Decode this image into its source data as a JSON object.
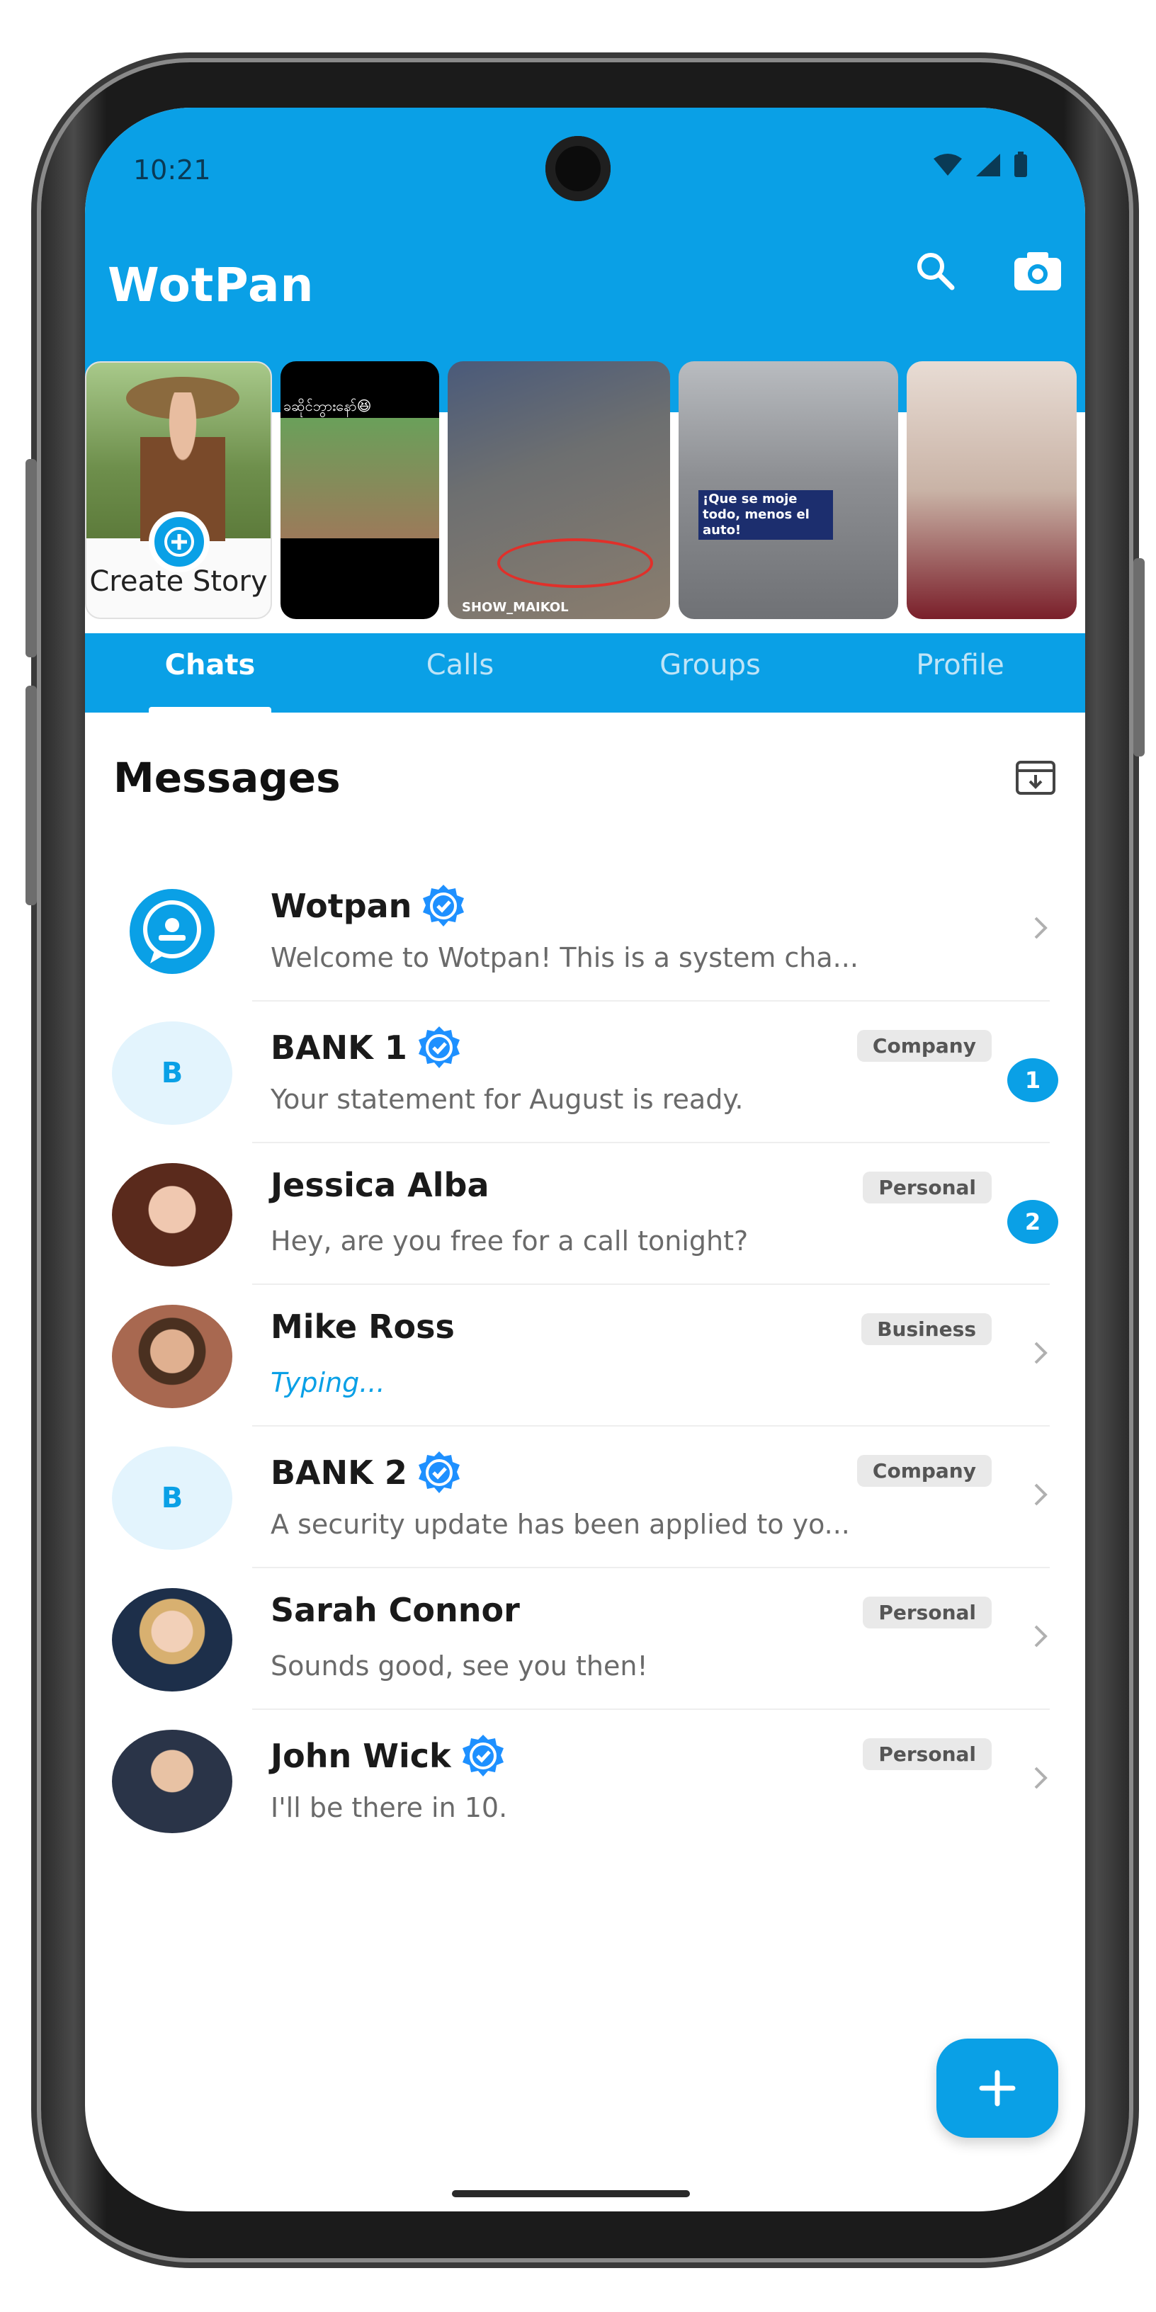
{
  "status_bar": {
    "time": "10:21"
  },
  "app_bar": {
    "title": "WotPan",
    "search_icon": "search-icon",
    "camera_icon": "camera-icon"
  },
  "stories": {
    "create_label": "Create Story",
    "items": [
      {
        "caption": "ခဆိုင်ဘွားနော်😆"
      },
      {
        "caption": "SHOW_MAIKOL"
      },
      {
        "caption": "¡Que se moje todo, menos el auto!"
      },
      {
        "caption": ""
      }
    ]
  },
  "tabs": [
    {
      "label": "Chats",
      "active": true
    },
    {
      "label": "Calls",
      "active": false
    },
    {
      "label": "Groups",
      "active": false
    },
    {
      "label": "Profile",
      "active": false
    }
  ],
  "messages": {
    "title": "Messages",
    "archive_icon": "archive-icon",
    "chats": [
      {
        "name": "Wotpan",
        "preview": "Welcome to Wotpan! This is a system cha...",
        "verified": true,
        "tag": "",
        "unread": "",
        "avatar": "logo"
      },
      {
        "name": "BANK 1",
        "preview": "Your statement for August is ready.",
        "verified": true,
        "tag": "Company",
        "unread": "1",
        "avatar": "B"
      },
      {
        "name": "Jessica Alba",
        "preview": "Hey, are you free for a call tonight?",
        "verified": false,
        "tag": "Personal",
        "unread": "2",
        "avatar": "photo"
      },
      {
        "name": "Mike Ross",
        "preview": "Typing...",
        "verified": false,
        "tag": "Business",
        "unread": "",
        "avatar": "photo"
      },
      {
        "name": "BANK 2",
        "preview": "A security update has been applied to yo...",
        "verified": true,
        "tag": "Company",
        "unread": "",
        "avatar": "B"
      },
      {
        "name": "Sarah Connor",
        "preview": "Sounds good, see you then!",
        "verified": false,
        "tag": "Personal",
        "unread": "",
        "avatar": "photo"
      },
      {
        "name": "John Wick",
        "preview": "I'll be there in 10.",
        "verified": true,
        "tag": "Personal",
        "unread": "",
        "avatar": "photo"
      }
    ]
  },
  "colors": {
    "accent": "#0aa0e6",
    "avatar_light": "#e3f4fd",
    "tag_bg": "#e9e9e9"
  }
}
